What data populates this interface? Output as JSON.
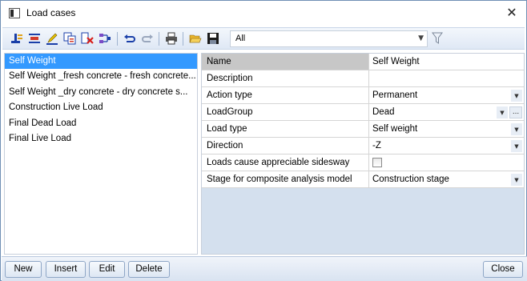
{
  "window": {
    "title": "Load cases",
    "close_glyph": "✕"
  },
  "toolbar": {
    "icons": [
      "new-case-icon",
      "insert-icon",
      "edit-icon",
      "copy-icon",
      "delete-icon",
      "structure-icon",
      "undo-icon",
      "redo-icon",
      "print-icon",
      "open-folder-icon",
      "save-icon"
    ],
    "filter": {
      "value": "All",
      "arrow": "▼"
    },
    "filter_icon": "funnel-icon"
  },
  "load_cases": [
    "Self Weight",
    "Self Weight _fresh concrete - fresh concrete...",
    "Self Weight _dry concrete - dry concrete s...",
    "Construction Live Load",
    "Final Dead Load",
    "Final Live Load"
  ],
  "selected_index": 0,
  "properties": {
    "name_label": "Name",
    "name_value": "Self Weight",
    "description_label": "Description",
    "description_value": "",
    "action_type_label": "Action type",
    "action_type_value": "Permanent",
    "loadgroup_label": "LoadGroup",
    "loadgroup_value": "Dead",
    "load_type_label": "Load type",
    "load_type_value": "Self weight",
    "direction_label": "Direction",
    "direction_value": "-Z",
    "sidesway_label": "Loads cause appreciable sidesway",
    "sidesway_checked": false,
    "stage_label": "Stage for composite analysis model",
    "stage_value": "Construction stage",
    "dropdown_arrow": "▼",
    "ellipsis": "..."
  },
  "buttons": {
    "new": "New",
    "insert": "Insert",
    "edit": "Edit",
    "delete": "Delete",
    "close": "Close"
  },
  "colors": {
    "selection": "#3399ff",
    "toolbar": "#dfe8f5",
    "pane_bg": "#d4e0ee"
  }
}
